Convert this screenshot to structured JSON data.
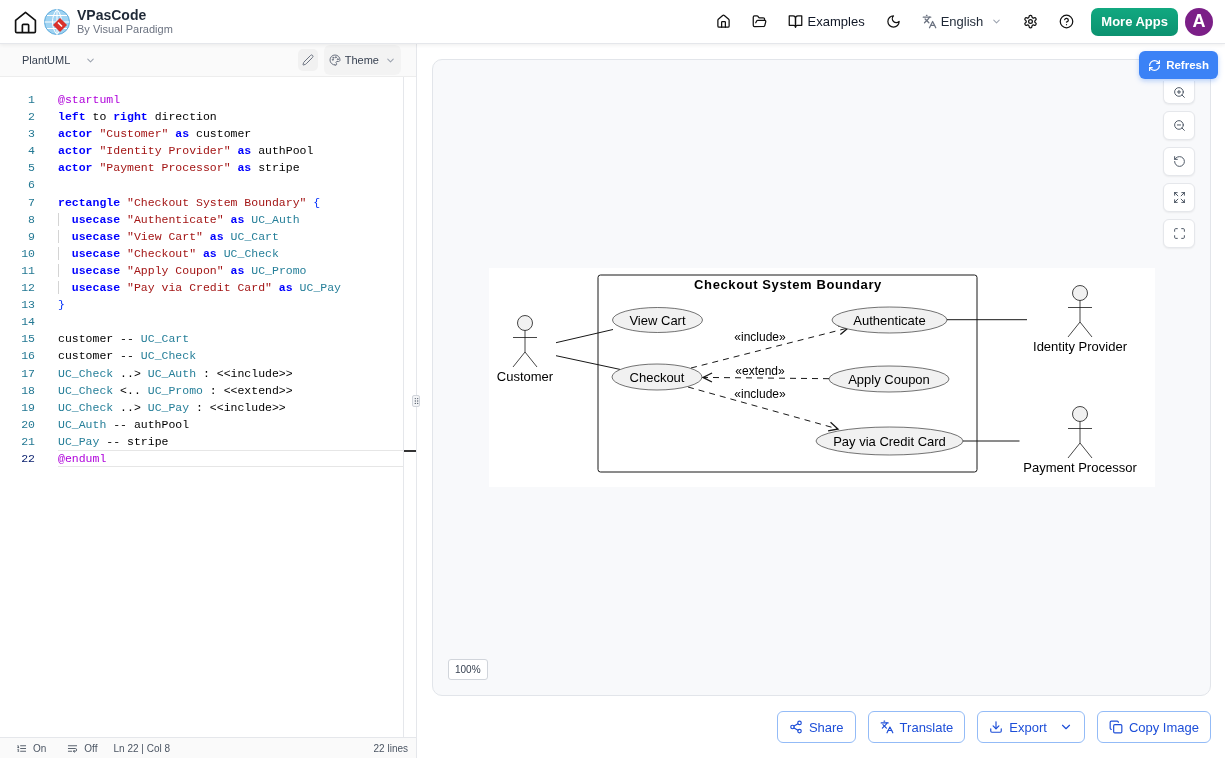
{
  "header": {
    "app_name": "VPasCode",
    "app_subtitle": "By Visual Paradigm",
    "examples_label": "Examples",
    "language": "English",
    "more_apps_label": "More Apps",
    "avatar_initial": "A"
  },
  "editor": {
    "language": "PlantUML",
    "theme_label": "Theme",
    "lines": [
      {
        "number": "1",
        "current": false,
        "tokens": [
          {
            "kind": "directive",
            "text": "@startuml"
          }
        ]
      },
      {
        "number": "2",
        "current": false,
        "tokens": [
          {
            "kind": "keyword",
            "text": "left"
          },
          {
            "kind": "text",
            "text": " to "
          },
          {
            "kind": "keyword",
            "text": "right"
          },
          {
            "kind": "text",
            "text": " direction"
          }
        ]
      },
      {
        "number": "3",
        "current": false,
        "tokens": [
          {
            "kind": "keyword",
            "text": "actor "
          },
          {
            "kind": "string",
            "text": "\"Customer\" "
          },
          {
            "kind": "keyword",
            "text": "as"
          },
          {
            "kind": "text",
            "text": " customer"
          }
        ]
      },
      {
        "number": "4",
        "current": false,
        "tokens": [
          {
            "kind": "keyword",
            "text": "actor "
          },
          {
            "kind": "string",
            "text": "\"Identity Provider\" "
          },
          {
            "kind": "keyword",
            "text": "as"
          },
          {
            "kind": "text",
            "text": " authPool"
          }
        ]
      },
      {
        "number": "5",
        "current": false,
        "tokens": [
          {
            "kind": "keyword",
            "text": "actor "
          },
          {
            "kind": "string",
            "text": "\"Payment Processor\" "
          },
          {
            "kind": "keyword",
            "text": "as"
          },
          {
            "kind": "text",
            "text": " stripe"
          }
        ]
      },
      {
        "number": "6",
        "current": false
      },
      {
        "number": "7",
        "current": false,
        "tokens": [
          {
            "kind": "keyword",
            "text": "rectangle "
          },
          {
            "kind": "string",
            "text": "\"Checkout System Boundary\" "
          },
          {
            "kind": "brace",
            "text": "{"
          }
        ]
      },
      {
        "number": "8",
        "current": false,
        "tokens": [
          {
            "kind": "keyword",
            "text": "  usecase "
          },
          {
            "kind": "string",
            "text": "\"Authenticate\" "
          },
          {
            "kind": "keyword",
            "text": "as "
          },
          {
            "kind": "alias",
            "text": "UC_Auth"
          }
        ]
      },
      {
        "number": "9",
        "current": false,
        "tokens": [
          {
            "kind": "keyword",
            "text": "  usecase "
          },
          {
            "kind": "string",
            "text": "\"View Cart\" "
          },
          {
            "kind": "keyword",
            "text": "as "
          },
          {
            "kind": "alias",
            "text": "UC_Cart"
          }
        ]
      },
      {
        "number": "10",
        "current": false,
        "tokens": [
          {
            "kind": "keyword",
            "text": "  usecase "
          },
          {
            "kind": "string",
            "text": "\"Checkout\" "
          },
          {
            "kind": "keyword",
            "text": "as "
          },
          {
            "kind": "alias",
            "text": "UC_Check"
          }
        ]
      },
      {
        "number": "11",
        "current": false,
        "tokens": [
          {
            "kind": "keyword",
            "text": "  usecase "
          },
          {
            "kind": "string",
            "text": "\"Apply Coupon\" "
          },
          {
            "kind": "keyword",
            "text": "as "
          },
          {
            "kind": "alias",
            "text": "UC_Promo"
          }
        ]
      },
      {
        "number": "12",
        "current": false,
        "tokens": [
          {
            "kind": "keyword",
            "text": "  usecase "
          },
          {
            "kind": "string",
            "text": "\"Pay via Credit Card\" "
          },
          {
            "kind": "keyword",
            "text": "as "
          },
          {
            "kind": "alias",
            "text": "UC_Pay"
          }
        ]
      },
      {
        "number": "13",
        "current": false,
        "tokens": [
          {
            "kind": "brace",
            "text": "}"
          }
        ]
      },
      {
        "number": "14",
        "current": false
      },
      {
        "number": "15",
        "current": false,
        "tokens": [
          {
            "kind": "text",
            "text": "customer -- "
          },
          {
            "kind": "alias",
            "text": "UC_Cart"
          }
        ]
      },
      {
        "number": "16",
        "current": false,
        "tokens": [
          {
            "kind": "text",
            "text": "customer -- "
          },
          {
            "kind": "alias",
            "text": "UC_Check"
          }
        ]
      },
      {
        "number": "17",
        "current": false,
        "tokens": [
          {
            "kind": "alias",
            "text": "UC_Check"
          },
          {
            "kind": "text",
            "text": " ..> "
          },
          {
            "kind": "alias",
            "text": "UC_Auth"
          },
          {
            "kind": "text",
            "text": " : <<include>>"
          }
        ]
      },
      {
        "number": "18",
        "current": false,
        "tokens": [
          {
            "kind": "alias",
            "text": "UC_Check"
          },
          {
            "kind": "text",
            "text": " <.. "
          },
          {
            "kind": "alias",
            "text": "UC_Promo"
          },
          {
            "kind": "text",
            "text": " : <<extend>>"
          }
        ]
      },
      {
        "number": "19",
        "current": false,
        "tokens": [
          {
            "kind": "alias",
            "text": "UC_Check"
          },
          {
            "kind": "text",
            "text": " ..> "
          },
          {
            "kind": "alias",
            "text": "UC_Pay"
          },
          {
            "kind": "text",
            "text": " : <<include>>"
          }
        ]
      },
      {
        "number": "20",
        "current": false,
        "tokens": [
          {
            "kind": "alias",
            "text": "UC_Auth"
          },
          {
            "kind": "text",
            "text": " -- authPool"
          }
        ]
      },
      {
        "number": "21",
        "current": false,
        "tokens": [
          {
            "kind": "alias",
            "text": "UC_Pay"
          },
          {
            "kind": "text",
            "text": " -- stripe"
          }
        ]
      },
      {
        "number": "22",
        "current": true,
        "tokens": [
          {
            "kind": "directive",
            "text": "@enduml"
          }
        ]
      }
    ]
  },
  "status_bar": {
    "line_numbers": "On",
    "word_wrap": "Off",
    "cursor_position": "Ln 22 | Col 8",
    "line_count": "22 lines"
  },
  "preview": {
    "refresh_label": "Refresh",
    "zoom_level": "100%",
    "diagram": {
      "boundary_title": "Checkout System Boundary",
      "actors": [
        {
          "name": "Customer"
        },
        {
          "name": "Identity Provider"
        },
        {
          "name": "Payment Processor"
        }
      ],
      "use_cases": [
        {
          "label": "View Cart"
        },
        {
          "label": "Authenticate"
        },
        {
          "label": "Checkout"
        },
        {
          "label": "Apply Coupon"
        },
        {
          "label": "Pay via Credit Card"
        }
      ],
      "relations": [
        {
          "kind": "association"
        },
        {
          "kind": "association"
        },
        {
          "kind": "include",
          "label": "«include»"
        },
        {
          "kind": "extend",
          "label": "«extend»"
        },
        {
          "kind": "include",
          "label": "«include»"
        },
        {
          "kind": "association"
        },
        {
          "kind": "association"
        }
      ]
    }
  },
  "actions": [
    {
      "kind": "share",
      "label": "Share",
      "has_menu": false
    },
    {
      "kind": "translate",
      "label": "Translate",
      "has_menu": false
    },
    {
      "kind": "export",
      "label": "Export",
      "has_menu": true
    },
    {
      "kind": "copy",
      "label": "Copy Image",
      "has_menu": false
    }
  ]
}
